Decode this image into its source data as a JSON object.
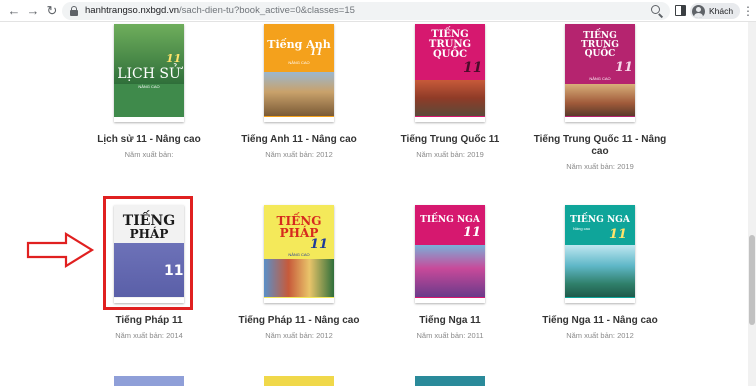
{
  "browser": {
    "url_host": "hanhtrangso.nxbgd.vn",
    "url_path": "/sach-dien-tu?book_active=0&classes=15",
    "profile_label": "Khách"
  },
  "books": [
    {
      "title": "Lịch sử 11 - Nâng cao",
      "year_line": "Năm xuất bản:",
      "cover": {
        "lines": [
          "LỊCH SỬ"
        ],
        "number": "11",
        "sub": "NÂNG CAO"
      }
    },
    {
      "title": "Tiếng Anh 11 - Nâng cao",
      "year_line": "Năm xuất bản: 2012",
      "cover": {
        "lines": [
          "Tiếng Anh"
        ],
        "number": "11",
        "sub": "NÂNG CAO"
      }
    },
    {
      "title": "Tiếng Trung Quốc 11",
      "year_line": "Năm xuất bản: 2019",
      "cover": {
        "lines": [
          "TIẾNG",
          "TRUNG",
          "QUỐC"
        ],
        "number": "11"
      }
    },
    {
      "title": "Tiếng Trung Quốc 11 - Nâng cao",
      "year_line": "Năm xuất bản: 2019",
      "cover": {
        "lines": [
          "TIẾNG",
          "TRUNG",
          "QUỐC"
        ],
        "number": "11",
        "sub": "NÂNG CAO"
      }
    },
    {
      "title": "Tiếng Pháp 11",
      "year_line": "Năm xuất bản: 2014",
      "cover": {
        "lines": [
          "TIẾNG",
          "PHÁP"
        ],
        "number": "11"
      }
    },
    {
      "title": "Tiếng Pháp 11 - Nâng cao",
      "year_line": "Năm xuất bản: 2012",
      "cover": {
        "lines": [
          "TIẾNG",
          "PHÁP"
        ],
        "number": "11",
        "sub": "NÂNG CAO"
      }
    },
    {
      "title": "Tiếng Nga 11",
      "year_line": "Năm xuất bản: 2011",
      "cover": {
        "lines": [
          "TIẾNG NGA"
        ],
        "number": "11"
      }
    },
    {
      "title": "Tiếng Nga 11 - Nâng cao",
      "year_line": "Năm xuất bản: 2012",
      "cover": {
        "lines": [
          "TIẾNG NGA"
        ],
        "number": "11",
        "sub": "Nâng cao"
      }
    }
  ],
  "colors": {
    "highlight": "#e02020",
    "title_text": "#333333",
    "meta_text": "#8a8a8a"
  }
}
